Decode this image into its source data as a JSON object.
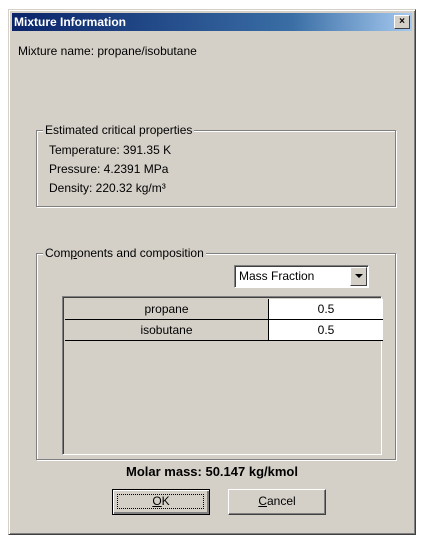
{
  "window": {
    "title": "Mixture Information",
    "close_glyph": "×"
  },
  "mixture": {
    "name_label": "Mixture name:",
    "name_value": "propane/isobutane"
  },
  "critical": {
    "legend": "Estimated critical properties",
    "temperature": "Temperature:  391.35 K",
    "pressure": "Pressure:  4.2391 MPa",
    "density": "Density:  220.32 kg/m³"
  },
  "components": {
    "legend_pre": "Com",
    "legend_accel": "p",
    "legend_post": "onents and composition",
    "basis_selected": "Mass Fraction",
    "rows": [
      {
        "name": "propane",
        "value": "0.5"
      },
      {
        "name": "isobutane",
        "value": "0.5"
      }
    ]
  },
  "summary": {
    "molar_mass": "Molar mass:  50.147 kg/kmol"
  },
  "buttons": {
    "ok_accel": "O",
    "ok_rest": "K",
    "cancel_accel": "C",
    "cancel_rest": "ancel"
  },
  "icons": {
    "close": "close-icon",
    "dropdown": "chevron-down-icon"
  },
  "colors": {
    "titlebar_start": "#0a246a",
    "titlebar_end": "#a6caf0",
    "face": "#d4d0c8"
  }
}
